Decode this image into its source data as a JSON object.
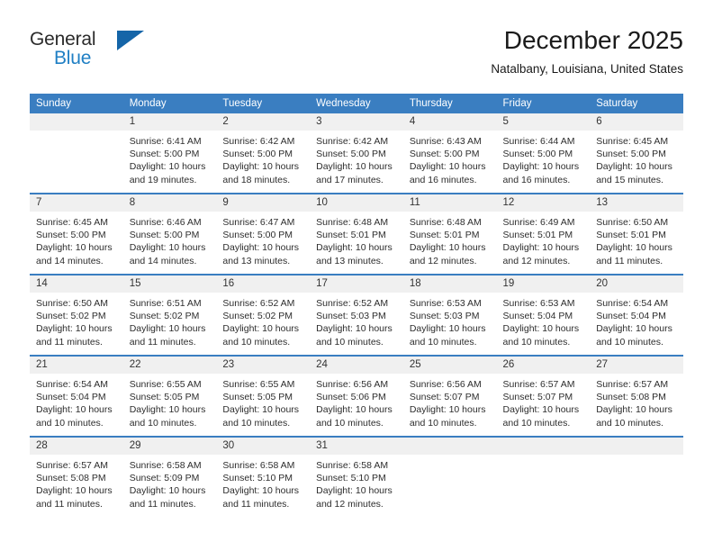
{
  "brand": {
    "line1": "General",
    "line2": "Blue",
    "triangle_color": "#1565a8",
    "blue_color": "#1f7fc4"
  },
  "header": {
    "title": "December 2025",
    "subtitle": "Natalbany, Louisiana, United States"
  },
  "theme": {
    "header_bar": "#3a7ec1",
    "daynum_band": "#f0f0f0",
    "text": "#2d2d2d"
  },
  "weekday_headers": [
    "Sunday",
    "Monday",
    "Tuesday",
    "Wednesday",
    "Thursday",
    "Friday",
    "Saturday"
  ],
  "weeks": [
    [
      {
        "day": "",
        "sunrise": "",
        "sunset": "",
        "daylight_1": "",
        "daylight_2": "",
        "blank": true
      },
      {
        "day": "1",
        "sunrise": "Sunrise: 6:41 AM",
        "sunset": "Sunset: 5:00 PM",
        "daylight_1": "Daylight: 10 hours",
        "daylight_2": "and 19 minutes."
      },
      {
        "day": "2",
        "sunrise": "Sunrise: 6:42 AM",
        "sunset": "Sunset: 5:00 PM",
        "daylight_1": "Daylight: 10 hours",
        "daylight_2": "and 18 minutes."
      },
      {
        "day": "3",
        "sunrise": "Sunrise: 6:42 AM",
        "sunset": "Sunset: 5:00 PM",
        "daylight_1": "Daylight: 10 hours",
        "daylight_2": "and 17 minutes."
      },
      {
        "day": "4",
        "sunrise": "Sunrise: 6:43 AM",
        "sunset": "Sunset: 5:00 PM",
        "daylight_1": "Daylight: 10 hours",
        "daylight_2": "and 16 minutes."
      },
      {
        "day": "5",
        "sunrise": "Sunrise: 6:44 AM",
        "sunset": "Sunset: 5:00 PM",
        "daylight_1": "Daylight: 10 hours",
        "daylight_2": "and 16 minutes."
      },
      {
        "day": "6",
        "sunrise": "Sunrise: 6:45 AM",
        "sunset": "Sunset: 5:00 PM",
        "daylight_1": "Daylight: 10 hours",
        "daylight_2": "and 15 minutes."
      }
    ],
    [
      {
        "day": "7",
        "sunrise": "Sunrise: 6:45 AM",
        "sunset": "Sunset: 5:00 PM",
        "daylight_1": "Daylight: 10 hours",
        "daylight_2": "and 14 minutes."
      },
      {
        "day": "8",
        "sunrise": "Sunrise: 6:46 AM",
        "sunset": "Sunset: 5:00 PM",
        "daylight_1": "Daylight: 10 hours",
        "daylight_2": "and 14 minutes."
      },
      {
        "day": "9",
        "sunrise": "Sunrise: 6:47 AM",
        "sunset": "Sunset: 5:00 PM",
        "daylight_1": "Daylight: 10 hours",
        "daylight_2": "and 13 minutes."
      },
      {
        "day": "10",
        "sunrise": "Sunrise: 6:48 AM",
        "sunset": "Sunset: 5:01 PM",
        "daylight_1": "Daylight: 10 hours",
        "daylight_2": "and 13 minutes."
      },
      {
        "day": "11",
        "sunrise": "Sunrise: 6:48 AM",
        "sunset": "Sunset: 5:01 PM",
        "daylight_1": "Daylight: 10 hours",
        "daylight_2": "and 12 minutes."
      },
      {
        "day": "12",
        "sunrise": "Sunrise: 6:49 AM",
        "sunset": "Sunset: 5:01 PM",
        "daylight_1": "Daylight: 10 hours",
        "daylight_2": "and 12 minutes."
      },
      {
        "day": "13",
        "sunrise": "Sunrise: 6:50 AM",
        "sunset": "Sunset: 5:01 PM",
        "daylight_1": "Daylight: 10 hours",
        "daylight_2": "and 11 minutes."
      }
    ],
    [
      {
        "day": "14",
        "sunrise": "Sunrise: 6:50 AM",
        "sunset": "Sunset: 5:02 PM",
        "daylight_1": "Daylight: 10 hours",
        "daylight_2": "and 11 minutes."
      },
      {
        "day": "15",
        "sunrise": "Sunrise: 6:51 AM",
        "sunset": "Sunset: 5:02 PM",
        "daylight_1": "Daylight: 10 hours",
        "daylight_2": "and 11 minutes."
      },
      {
        "day": "16",
        "sunrise": "Sunrise: 6:52 AM",
        "sunset": "Sunset: 5:02 PM",
        "daylight_1": "Daylight: 10 hours",
        "daylight_2": "and 10 minutes."
      },
      {
        "day": "17",
        "sunrise": "Sunrise: 6:52 AM",
        "sunset": "Sunset: 5:03 PM",
        "daylight_1": "Daylight: 10 hours",
        "daylight_2": "and 10 minutes."
      },
      {
        "day": "18",
        "sunrise": "Sunrise: 6:53 AM",
        "sunset": "Sunset: 5:03 PM",
        "daylight_1": "Daylight: 10 hours",
        "daylight_2": "and 10 minutes."
      },
      {
        "day": "19",
        "sunrise": "Sunrise: 6:53 AM",
        "sunset": "Sunset: 5:04 PM",
        "daylight_1": "Daylight: 10 hours",
        "daylight_2": "and 10 minutes."
      },
      {
        "day": "20",
        "sunrise": "Sunrise: 6:54 AM",
        "sunset": "Sunset: 5:04 PM",
        "daylight_1": "Daylight: 10 hours",
        "daylight_2": "and 10 minutes."
      }
    ],
    [
      {
        "day": "21",
        "sunrise": "Sunrise: 6:54 AM",
        "sunset": "Sunset: 5:04 PM",
        "daylight_1": "Daylight: 10 hours",
        "daylight_2": "and 10 minutes."
      },
      {
        "day": "22",
        "sunrise": "Sunrise: 6:55 AM",
        "sunset": "Sunset: 5:05 PM",
        "daylight_1": "Daylight: 10 hours",
        "daylight_2": "and 10 minutes."
      },
      {
        "day": "23",
        "sunrise": "Sunrise: 6:55 AM",
        "sunset": "Sunset: 5:05 PM",
        "daylight_1": "Daylight: 10 hours",
        "daylight_2": "and 10 minutes."
      },
      {
        "day": "24",
        "sunrise": "Sunrise: 6:56 AM",
        "sunset": "Sunset: 5:06 PM",
        "daylight_1": "Daylight: 10 hours",
        "daylight_2": "and 10 minutes."
      },
      {
        "day": "25",
        "sunrise": "Sunrise: 6:56 AM",
        "sunset": "Sunset: 5:07 PM",
        "daylight_1": "Daylight: 10 hours",
        "daylight_2": "and 10 minutes."
      },
      {
        "day": "26",
        "sunrise": "Sunrise: 6:57 AM",
        "sunset": "Sunset: 5:07 PM",
        "daylight_1": "Daylight: 10 hours",
        "daylight_2": "and 10 minutes."
      },
      {
        "day": "27",
        "sunrise": "Sunrise: 6:57 AM",
        "sunset": "Sunset: 5:08 PM",
        "daylight_1": "Daylight: 10 hours",
        "daylight_2": "and 10 minutes."
      }
    ],
    [
      {
        "day": "28",
        "sunrise": "Sunrise: 6:57 AM",
        "sunset": "Sunset: 5:08 PM",
        "daylight_1": "Daylight: 10 hours",
        "daylight_2": "and 11 minutes."
      },
      {
        "day": "29",
        "sunrise": "Sunrise: 6:58 AM",
        "sunset": "Sunset: 5:09 PM",
        "daylight_1": "Daylight: 10 hours",
        "daylight_2": "and 11 minutes."
      },
      {
        "day": "30",
        "sunrise": "Sunrise: 6:58 AM",
        "sunset": "Sunset: 5:10 PM",
        "daylight_1": "Daylight: 10 hours",
        "daylight_2": "and 11 minutes."
      },
      {
        "day": "31",
        "sunrise": "Sunrise: 6:58 AM",
        "sunset": "Sunset: 5:10 PM",
        "daylight_1": "Daylight: 10 hours",
        "daylight_2": "and 12 minutes."
      },
      {
        "day": "",
        "sunrise": "",
        "sunset": "",
        "daylight_1": "",
        "daylight_2": "",
        "blank": true
      },
      {
        "day": "",
        "sunrise": "",
        "sunset": "",
        "daylight_1": "",
        "daylight_2": "",
        "blank": true
      },
      {
        "day": "",
        "sunrise": "",
        "sunset": "",
        "daylight_1": "",
        "daylight_2": "",
        "blank": true
      }
    ]
  ]
}
